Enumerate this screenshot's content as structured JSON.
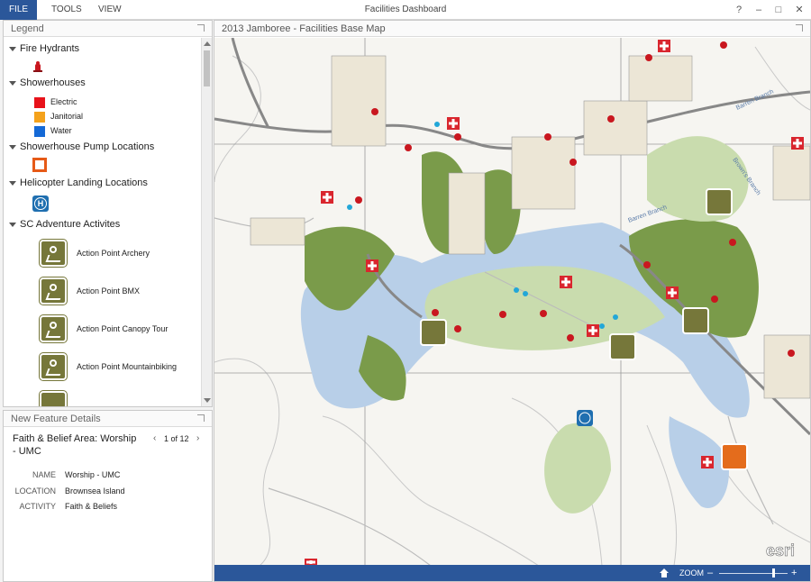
{
  "titlebar": {
    "title": "Facilities Dashboard",
    "menu": [
      "FILE",
      "TOOLS",
      "VIEW"
    ],
    "help": "?",
    "minimize": "–",
    "maximize": "□",
    "close": "✕"
  },
  "legend": {
    "header": "Legend",
    "groups": {
      "hydrants": "Fire Hydrants",
      "showerhouses": "Showerhouses",
      "pumps": "Showerhouse Pump Locations",
      "helicopter": "Helicopter Landing Locations",
      "adventure": "SC Adventure Activites"
    },
    "showerhouse_items": [
      {
        "label": "Electric",
        "color": "#e8121a"
      },
      {
        "label": "Janitorial",
        "color": "#f4a21b"
      },
      {
        "label": "Water",
        "color": "#1469d6"
      }
    ],
    "heli_glyph": "H",
    "activities": [
      "Action Point Archery",
      "Action Point BMX",
      "Action Point Canopy Tour",
      "Action Point Mountainbiking"
    ]
  },
  "details": {
    "header": "New Feature Details",
    "title": "Faith & Belief Area: Worship - UMC",
    "pager": "1 of 12",
    "prev": "‹",
    "next": "›",
    "attributes": [
      {
        "key": "NAME",
        "value": "Worship - UMC"
      },
      {
        "key": "LOCATION",
        "value": "Brownsea Island"
      },
      {
        "key": "ACTIVITY",
        "value": "Faith & Beliefs"
      }
    ]
  },
  "map": {
    "header": "2013 Jamboree - Facilities Base Map",
    "zoom_label": "ZOOM",
    "zoom_minus": "–",
    "zoom_plus": "+",
    "zoom_level": 0.79,
    "attribution": "esri",
    "stream_label_1": "Barren Branch",
    "stream_label_2": "Barren Branch",
    "stream_label_3": "Brown's Branch",
    "colors": {
      "land": "#f6f5f1",
      "green": "#7a9b4a",
      "light_green": "#c9dcae",
      "water": "#b8cfe8",
      "road": "#9a9a9a",
      "footer": "#2b579a"
    }
  }
}
